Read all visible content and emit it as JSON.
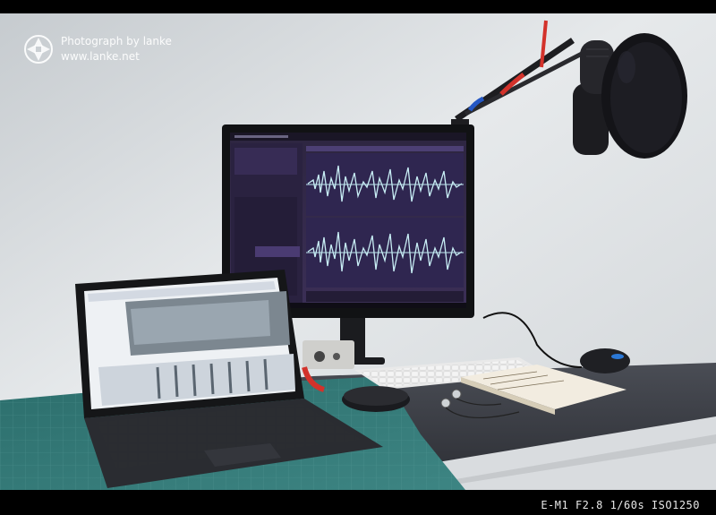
{
  "watermark": {
    "line1": "Photograph by lanke",
    "line2": "www.lanke.net"
  },
  "exif": "E-M1  F2.8  1/60s  ISO1250",
  "colors": {
    "wall": "#dfe3e6",
    "desk": "#3a3d44",
    "mat": "#2f6f6e",
    "screen_purple": "#3a2e52",
    "waveform": "#bfe8f0",
    "cable_red": "#d3322b"
  },
  "objects": {
    "monitor": "monitor",
    "laptop": "tablet-laptop",
    "microphone": "condenser-microphone",
    "pop_filter": "pop-filter",
    "keyboard": "keyboard",
    "mouse": "mouse",
    "notebook": "notebook",
    "earphones": "earphones",
    "speaker": "portable-speaker",
    "audio_interface": "audio-interface"
  }
}
